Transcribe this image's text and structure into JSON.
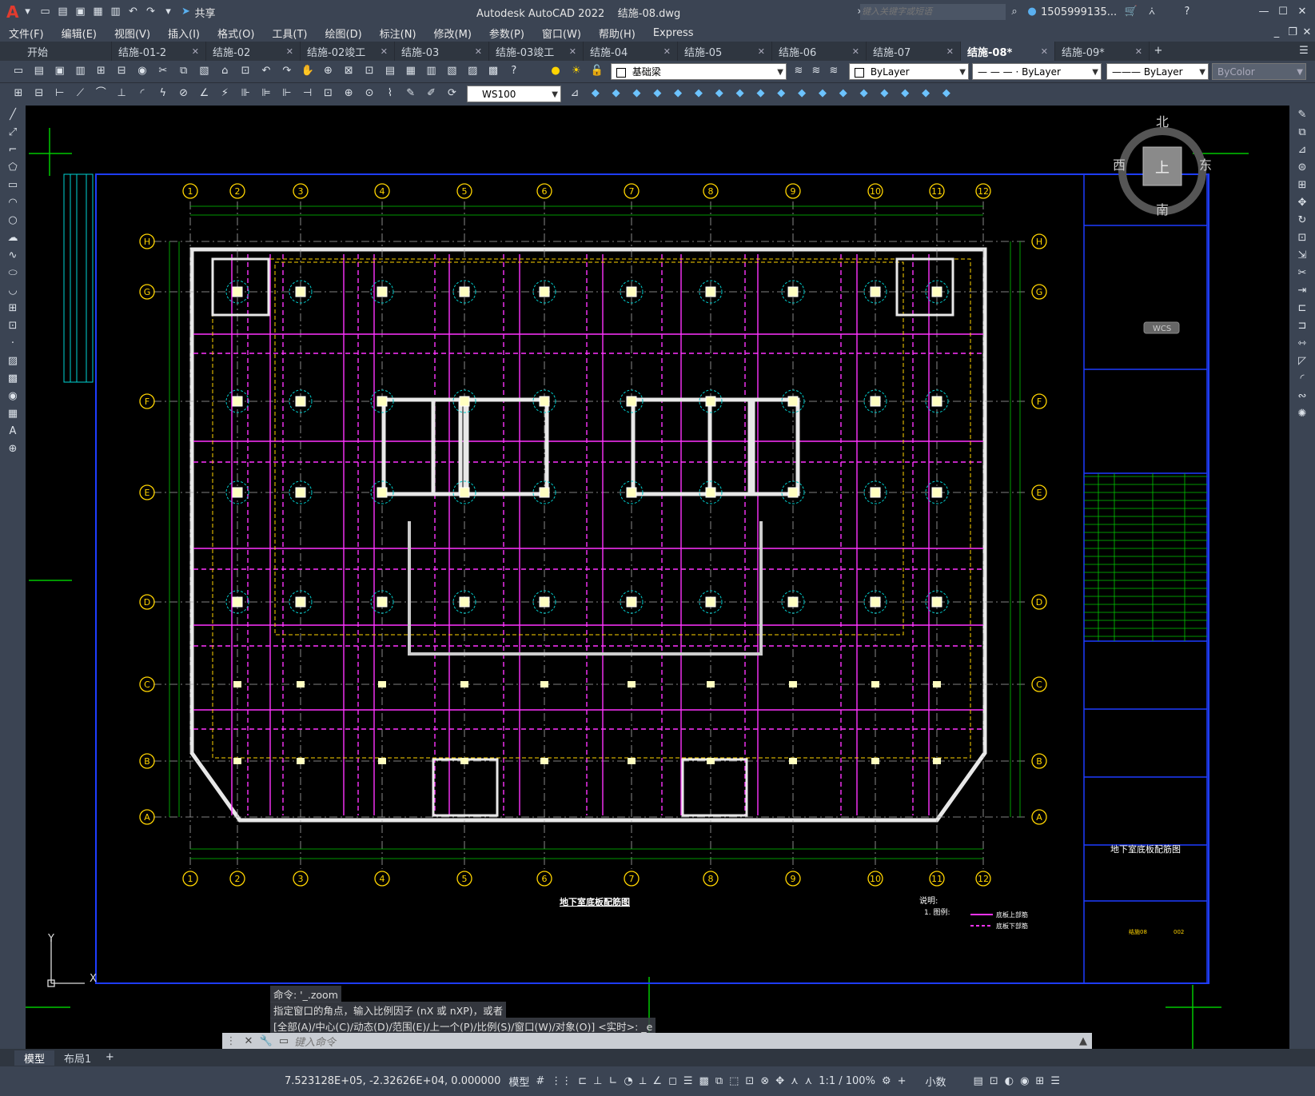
{
  "app": {
    "logo": "A",
    "title": "Autodesk AutoCAD 2022",
    "filename": "结施-08.dwg",
    "search_placeholder": "键入关键字或短语",
    "user": "1505999135...",
    "share_label": "共享"
  },
  "menu": [
    "文件(F)",
    "编辑(E)",
    "视图(V)",
    "插入(I)",
    "格式(O)",
    "工具(T)",
    "绘图(D)",
    "标注(N)",
    "修改(M)",
    "参数(P)",
    "窗口(W)",
    "帮助(H)",
    "Express"
  ],
  "tabs": [
    {
      "label": "开始",
      "active": false
    },
    {
      "label": "结施-01-2",
      "active": false
    },
    {
      "label": "结施-02",
      "active": false
    },
    {
      "label": "结施-02竣工",
      "active": false
    },
    {
      "label": "结施-03",
      "active": false
    },
    {
      "label": "结施-03竣工",
      "active": false
    },
    {
      "label": "结施-04",
      "active": false
    },
    {
      "label": "结施-05",
      "active": false
    },
    {
      "label": "结施-06",
      "active": false
    },
    {
      "label": "结施-07",
      "active": false
    },
    {
      "label": "结施-08*",
      "active": true
    },
    {
      "label": "结施-09*",
      "active": false
    }
  ],
  "toolbar": {
    "layer": "基础梁",
    "color": "ByLayer",
    "linetype": "ByLayer",
    "lineweight": "ByLayer",
    "plotstyle": "ByColor",
    "textstyle": "WS100"
  },
  "viewcube": {
    "north": "北",
    "south": "南",
    "east": "东",
    "west": "西",
    "top": "上",
    "wcs": "WCS"
  },
  "drawing": {
    "grid_cols": [
      "1",
      "2",
      "3",
      "4",
      "5",
      "6",
      "7",
      "8",
      "9",
      "10",
      "11",
      "12"
    ],
    "grid_rows": [
      "H",
      "G",
      "F",
      "E",
      "D",
      "C",
      "B",
      "A"
    ],
    "plan_title": "地下室底板配筋图",
    "notes_label": "说明:",
    "notes_item": "1. 图例:",
    "legend_top": "底板上部筋",
    "legend_bottom": "底板下部筋",
    "titleblock_name": "地下室底板配筋图",
    "sheet_no": "结施08",
    "sheet_page": "002"
  },
  "command": {
    "history": [
      "命令: '_.zoom",
      "指定窗口的角点，输入比例因子 (nX 或 nXP)，或者",
      "[全部(A)/中心(C)/动态(D)/范围(E)/上一个(P)/比例(S)/窗口(W)/对象(O)] <实时>: _e"
    ],
    "placeholder": "键入命令"
  },
  "layout_tabs": [
    "模型",
    "布局1"
  ],
  "status": {
    "coords": "7.523128E+05, -2.32626E+04, 0.000000",
    "space": "模型",
    "scale": "1:1 / 100%",
    "units": "小数"
  }
}
